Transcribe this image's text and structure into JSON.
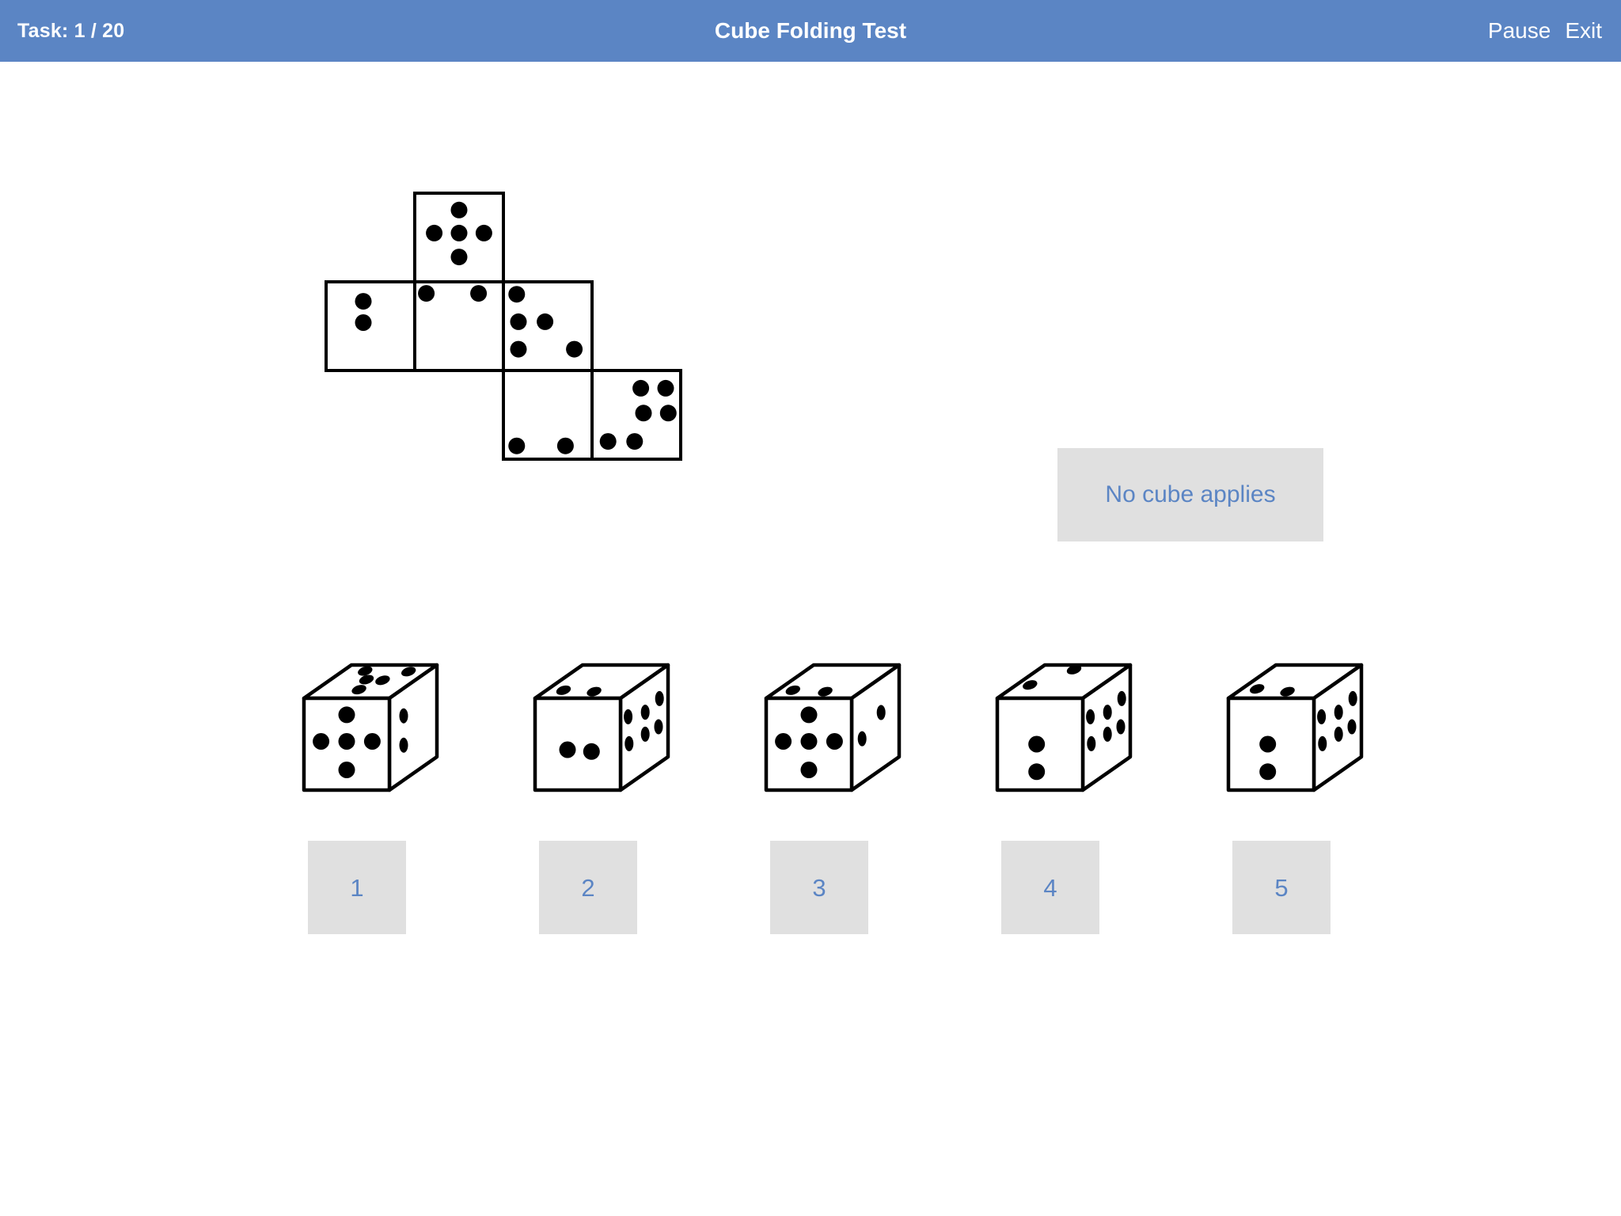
{
  "header": {
    "task_label": "Task: 1 / 20",
    "title": "Cube Folding Test",
    "pause_label": "Pause",
    "exit_label": "Exit",
    "background_color": "#5b85c4",
    "text_color": "#ffffff"
  },
  "colors": {
    "accent_blue": "#5b85c4",
    "button_gray": "#e0e0e0",
    "page_background": "#ffffff",
    "ink": "#000000"
  },
  "prompt": {
    "no_cube_label": "No cube applies"
  },
  "net": {
    "description": "Unfolded cube net, six square faces with dot patterns",
    "cell_size": 112,
    "faces": [
      {
        "id": "net-face-top",
        "grid_col": 1,
        "grid_row": 0,
        "pip_count": 5,
        "arrangement": "plus",
        "pips": [
          [
            0.5,
            0.19
          ],
          [
            0.22,
            0.45
          ],
          [
            0.5,
            0.45
          ],
          [
            0.78,
            0.45
          ],
          [
            0.5,
            0.72
          ]
        ]
      },
      {
        "id": "net-face-left",
        "grid_col": 0,
        "grid_row": 1,
        "pip_count": 2,
        "arrangement": "vertical-pair-upper",
        "pips": [
          [
            0.42,
            0.22
          ],
          [
            0.42,
            0.46
          ]
        ]
      },
      {
        "id": "net-face-middle",
        "grid_col": 1,
        "grid_row": 1,
        "pip_count": 2,
        "arrangement": "top-corners",
        "pips": [
          [
            0.13,
            0.13
          ],
          [
            0.72,
            0.13
          ]
        ]
      },
      {
        "id": "net-face-right",
        "grid_col": 2,
        "grid_row": 1,
        "pip_count": 5,
        "arrangement": "irregular",
        "pips": [
          [
            0.15,
            0.14
          ],
          [
            0.17,
            0.45
          ],
          [
            0.47,
            0.45
          ],
          [
            0.17,
            0.76
          ],
          [
            0.8,
            0.76
          ]
        ]
      },
      {
        "id": "net-face-bottom-middle",
        "grid_col": 2,
        "grid_row": 2,
        "pip_count": 2,
        "arrangement": "bottom-corners",
        "pips": [
          [
            0.15,
            0.85
          ],
          [
            0.7,
            0.85
          ]
        ]
      },
      {
        "id": "net-face-bottom-right",
        "grid_col": 3,
        "grid_row": 2,
        "pip_count": 6,
        "arrangement": "irregular-six",
        "pips": [
          [
            0.55,
            0.2
          ],
          [
            0.83,
            0.2
          ],
          [
            0.58,
            0.48
          ],
          [
            0.86,
            0.48
          ],
          [
            0.18,
            0.8
          ],
          [
            0.48,
            0.8
          ]
        ]
      }
    ]
  },
  "answers": [
    {
      "number": "1",
      "cube_name": "answer-cube-1",
      "front": {
        "pip_count": 5,
        "arrangement": "plus",
        "pips": [
          [
            0.5,
            0.18
          ],
          [
            0.2,
            0.47
          ],
          [
            0.5,
            0.47
          ],
          [
            0.8,
            0.47
          ],
          [
            0.5,
            0.78
          ]
        ]
      },
      "top": {
        "pip_count": 5,
        "arrangement": "irregular",
        "pips": [
          [
            0.26,
            0.18
          ],
          [
            0.42,
            0.44
          ],
          [
            0.62,
            0.46
          ],
          [
            0.78,
            0.2
          ],
          [
            0.5,
            0.74
          ]
        ]
      },
      "right": {
        "pip_count": 2,
        "arrangement": "vertical-pair",
        "pips": [
          [
            0.3,
            0.3
          ],
          [
            0.3,
            0.62
          ]
        ]
      }
    },
    {
      "number": "2",
      "cube_name": "answer-cube-2",
      "front": {
        "pip_count": 2,
        "arrangement": "horizontal-pair",
        "pips": [
          [
            0.38,
            0.56
          ],
          [
            0.66,
            0.58
          ]
        ]
      },
      "top": {
        "pip_count": 2,
        "arrangement": "front-edge-pair",
        "pips": [
          [
            0.2,
            0.76
          ],
          [
            0.58,
            0.8
          ]
        ]
      },
      "right": {
        "pip_count": 6,
        "arrangement": "two-columns",
        "pips": [
          [
            0.16,
            0.26
          ],
          [
            0.52,
            0.34
          ],
          [
            0.82,
            0.3
          ],
          [
            0.18,
            0.56
          ],
          [
            0.52,
            0.58
          ],
          [
            0.8,
            0.6
          ]
        ]
      }
    },
    {
      "number": "3",
      "cube_name": "answer-cube-3",
      "front": {
        "pip_count": 5,
        "arrangement": "plus",
        "pips": [
          [
            0.5,
            0.18
          ],
          [
            0.2,
            0.47
          ],
          [
            0.5,
            0.47
          ],
          [
            0.8,
            0.47
          ],
          [
            0.5,
            0.78
          ]
        ]
      },
      "top": {
        "pip_count": 2,
        "arrangement": "front-edge-pair",
        "pips": [
          [
            0.18,
            0.76
          ],
          [
            0.58,
            0.8
          ]
        ]
      },
      "right": {
        "pip_count": 2,
        "arrangement": "vertical-offset-pair",
        "pips": [
          [
            0.22,
            0.52
          ],
          [
            0.62,
            0.38
          ]
        ]
      }
    },
    {
      "number": "4",
      "cube_name": "answer-cube-4",
      "front": {
        "pip_count": 2,
        "arrangement": "vertical-pair",
        "pips": [
          [
            0.46,
            0.5
          ],
          [
            0.46,
            0.8
          ]
        ]
      },
      "top": {
        "pip_count": 2,
        "arrangement": "left-back-pair",
        "pips": [
          [
            0.42,
            0.14
          ],
          [
            0.16,
            0.6
          ]
        ]
      },
      "right": {
        "pip_count": 6,
        "arrangement": "two-columns",
        "pips": [
          [
            0.16,
            0.26
          ],
          [
            0.52,
            0.34
          ],
          [
            0.82,
            0.3
          ],
          [
            0.18,
            0.56
          ],
          [
            0.52,
            0.58
          ],
          [
            0.8,
            0.6
          ]
        ]
      }
    },
    {
      "number": "5",
      "cube_name": "answer-cube-5",
      "front": {
        "pip_count": 2,
        "arrangement": "vertical-pair",
        "pips": [
          [
            0.46,
            0.5
          ],
          [
            0.46,
            0.8
          ]
        ]
      },
      "top": {
        "pip_count": 2,
        "arrangement": "front-edge-pair",
        "pips": [
          [
            0.18,
            0.72
          ],
          [
            0.58,
            0.8
          ]
        ]
      },
      "right": {
        "pip_count": 6,
        "arrangement": "two-columns",
        "pips": [
          [
            0.16,
            0.26
          ],
          [
            0.52,
            0.34
          ],
          [
            0.82,
            0.3
          ],
          [
            0.18,
            0.56
          ],
          [
            0.52,
            0.58
          ],
          [
            0.8,
            0.6
          ]
        ]
      }
    }
  ],
  "layout": {
    "cube_x_positions": [
      372,
      664,
      956,
      1248,
      1540
    ],
    "number_x_positions": [
      389,
      681,
      973,
      1265,
      1557
    ]
  }
}
